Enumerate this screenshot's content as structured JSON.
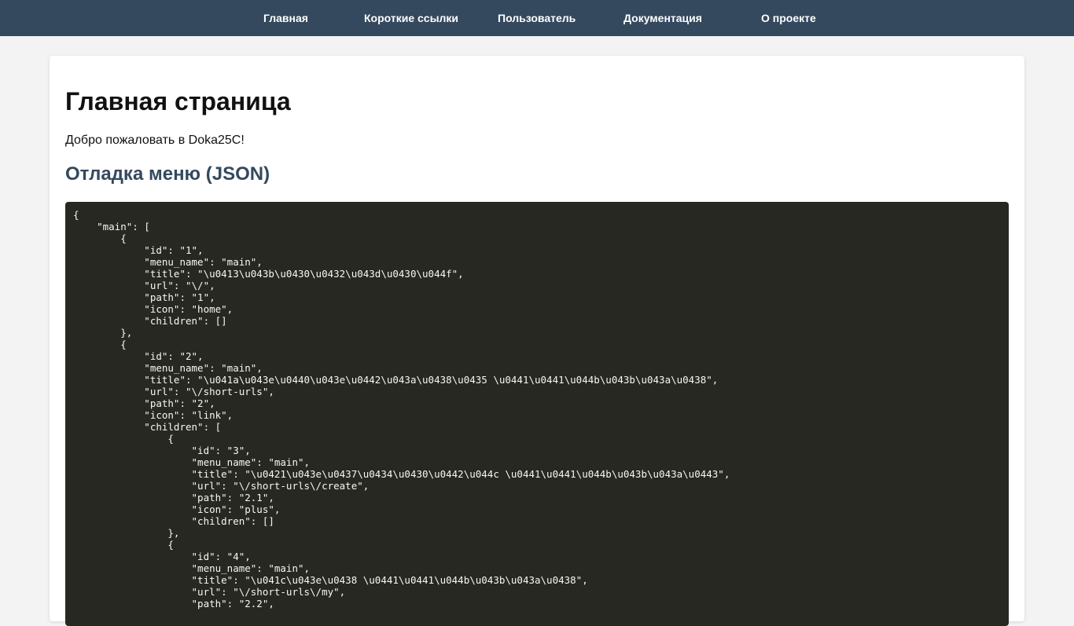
{
  "nav": {
    "items": [
      {
        "label": "Главная"
      },
      {
        "label": "Короткие ссылки"
      },
      {
        "label": "Пользователь"
      },
      {
        "label": "Документация"
      },
      {
        "label": "О проекте"
      }
    ]
  },
  "main": {
    "title": "Главная страница",
    "welcome": "Добро пожаловать в Doka25C!",
    "debug_title": "Отладка меню (JSON)",
    "debug_json": "{\n    \"main\": [\n        {\n            \"id\": \"1\",\n            \"menu_name\": \"main\",\n            \"title\": \"\\u0413\\u043b\\u0430\\u0432\\u043d\\u0430\\u044f\",\n            \"url\": \"\\/\",\n            \"path\": \"1\",\n            \"icon\": \"home\",\n            \"children\": []\n        },\n        {\n            \"id\": \"2\",\n            \"menu_name\": \"main\",\n            \"title\": \"\\u041a\\u043e\\u0440\\u043e\\u0442\\u043a\\u0438\\u0435 \\u0441\\u0441\\u044b\\u043b\\u043a\\u0438\",\n            \"url\": \"\\/short-urls\",\n            \"path\": \"2\",\n            \"icon\": \"link\",\n            \"children\": [\n                {\n                    \"id\": \"3\",\n                    \"menu_name\": \"main\",\n                    \"title\": \"\\u0421\\u043e\\u0437\\u0434\\u0430\\u0442\\u044c \\u0441\\u0441\\u044b\\u043b\\u043a\\u0443\",\n                    \"url\": \"\\/short-urls\\/create\",\n                    \"path\": \"2.1\",\n                    \"icon\": \"plus\",\n                    \"children\": []\n                },\n                {\n                    \"id\": \"4\",\n                    \"menu_name\": \"main\",\n                    \"title\": \"\\u041c\\u043e\\u0438 \\u0441\\u0441\\u044b\\u043b\\u043a\\u0438\",\n                    \"url\": \"\\/short-urls\\/my\",\n                    \"path\": \"2.2\","
  },
  "colors": {
    "nav_bg": "#34495e",
    "section_title": "#34495e",
    "code_bg": "#272822",
    "page_bg": "#f3f3f3"
  }
}
